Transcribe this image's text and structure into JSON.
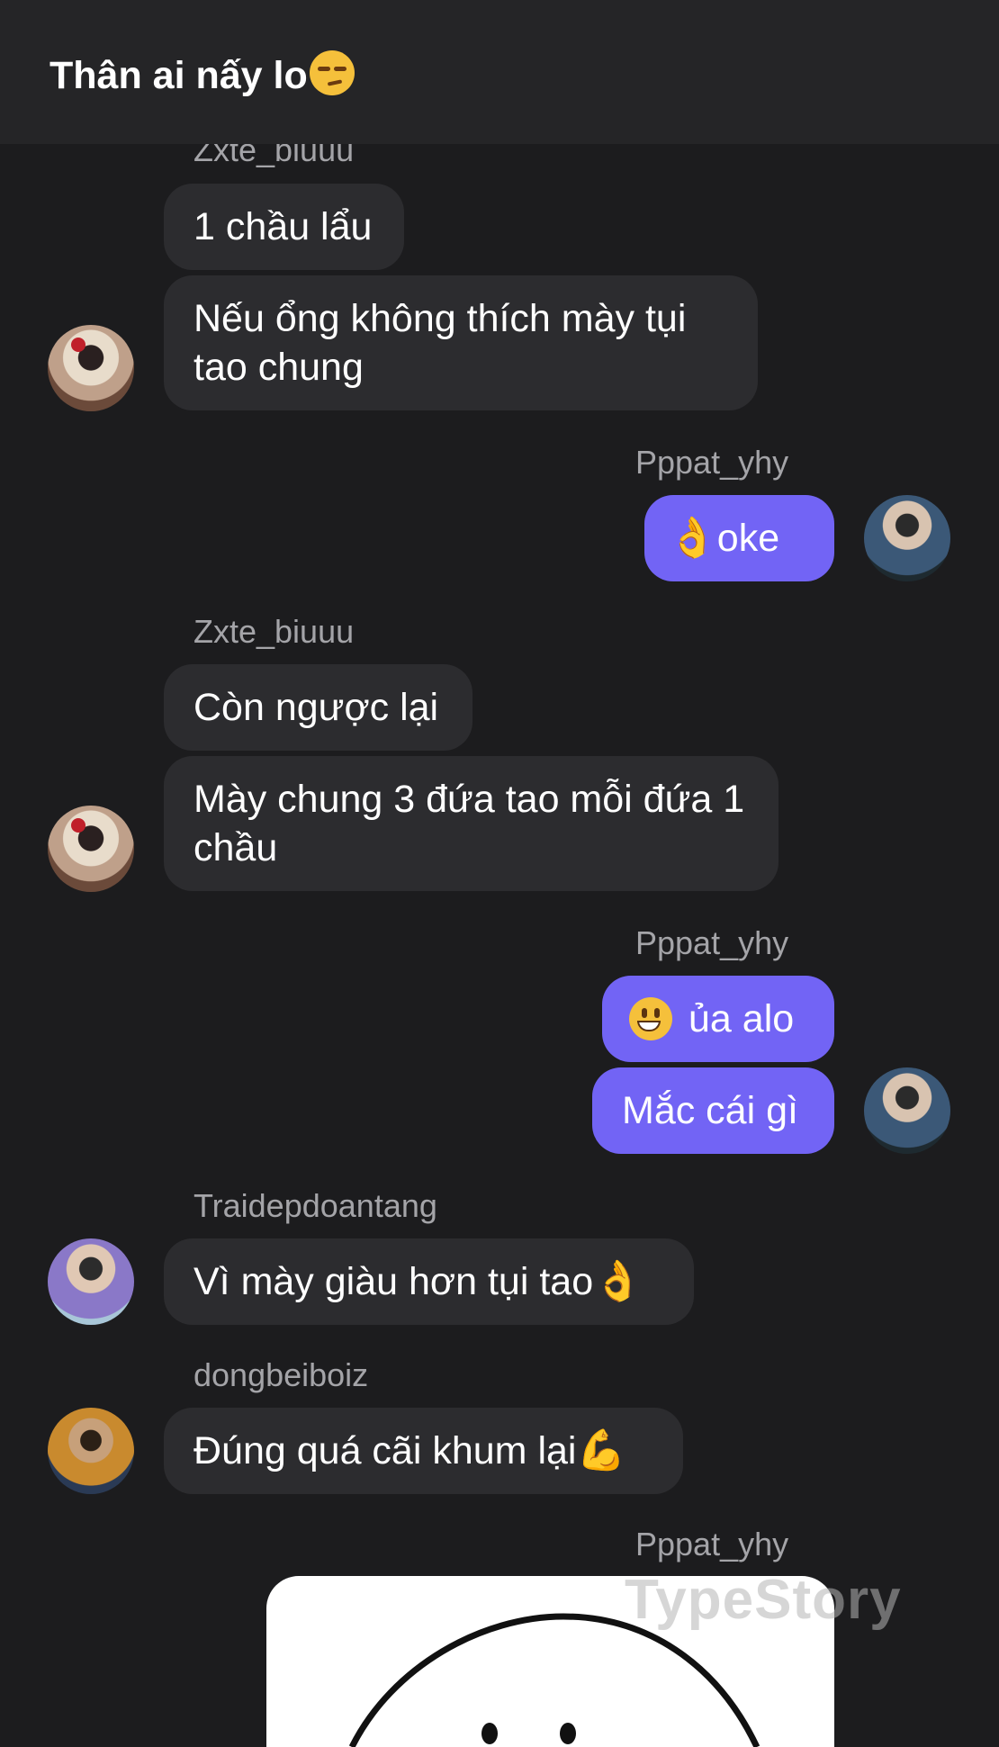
{
  "header": {
    "title": "Thân ai nấy lo",
    "title_emoji": "unamused-face-emoji"
  },
  "messages": [
    {
      "sender": "Zxte_biuuu",
      "bubbles": [
        "1 chầu lẩu",
        "Nếu ổng không thích mày tụi tao chung"
      ]
    },
    {
      "sender": "Pppat_yhy",
      "bubbles": [
        "oke"
      ],
      "emoji": "ok-hand-emoji"
    },
    {
      "sender": "Zxte_biuuu",
      "bubbles": [
        "Còn ngược lại",
        "Mày chung 3 đứa tao mỗi đứa 1 chầu"
      ]
    },
    {
      "sender": "Pppat_yhy",
      "bubbles": [
        "ủa alo",
        "Mắc cái gì"
      ],
      "emoji": "grinning-face-emoji"
    },
    {
      "sender": "Traidepdoantang",
      "bubbles": [
        "Vì mày giàu hơn tụi tao"
      ],
      "emoji": "ok-hand-emoji"
    },
    {
      "sender": "dongbeiboiz",
      "bubbles": [
        "Đúng quá cãi khum lại"
      ],
      "emoji": "flexed-biceps-emoji"
    },
    {
      "sender": "Pppat_yhy",
      "sticker": "smiley-face-sticker"
    }
  ],
  "watermark": "TypeStory"
}
